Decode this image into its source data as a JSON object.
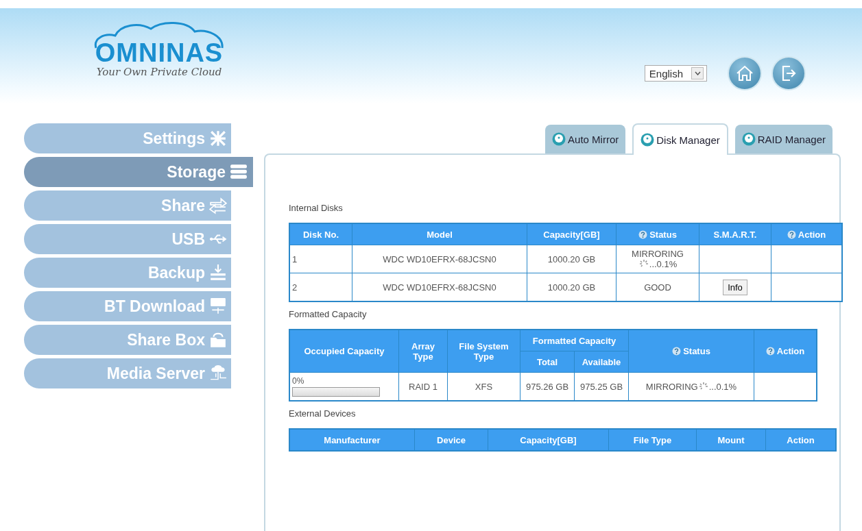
{
  "logo": {
    "name": "OMNINAS",
    "tagline": "Your Own Private Cloud"
  },
  "language": {
    "value": "English"
  },
  "sidebar": {
    "items": [
      {
        "label": "Settings",
        "selected": false
      },
      {
        "label": "Storage",
        "selected": true
      },
      {
        "label": "Share",
        "selected": false
      },
      {
        "label": "USB",
        "selected": false
      },
      {
        "label": "Backup",
        "selected": false
      },
      {
        "label": "BT Download",
        "selected": false
      },
      {
        "label": "Share Box",
        "selected": false
      },
      {
        "label": "Media Server",
        "selected": false
      }
    ]
  },
  "tabs": [
    {
      "label": "Auto Mirror",
      "selected": false
    },
    {
      "label": "Disk Manager",
      "selected": true
    },
    {
      "label": "RAID Manager",
      "selected": false
    }
  ],
  "internal_disks": {
    "title": "Internal Disks",
    "columns": [
      {
        "label": "Disk No."
      },
      {
        "label": "Model"
      },
      {
        "label": "Capacity[GB]"
      },
      {
        "label": "Status",
        "help": true
      },
      {
        "label": "S.M.A.R.T."
      },
      {
        "label": "Action",
        "help": true
      }
    ],
    "rows": [
      {
        "disk_no": "1",
        "model": "WDC WD10EFRX-68JCSN0",
        "capacity": "1000.20 GB",
        "status": "MIRRORING",
        "status_progress": "...0.1%"
      },
      {
        "disk_no": "2",
        "model": "WDC WD10EFRX-68JCSN0",
        "capacity": "1000.20 GB",
        "status": "GOOD",
        "smart_button": "Info"
      }
    ]
  },
  "formatted_capacity": {
    "title": "Formatted Capacity",
    "columns": {
      "occupied": "Occupied Capacity",
      "array_type": "Array Type",
      "fs_type": "File System Type",
      "formatted": "Formatted Capacity",
      "total": "Total",
      "available": "Available",
      "status": "Status",
      "action": "Action"
    },
    "rows": [
      {
        "occupied": "0%",
        "level": 0,
        "array_type": "RAID 1",
        "fs_type": "XFS",
        "total": "975.26 GB",
        "available": "975.25 GB",
        "status": "MIRRORING",
        "status_progress": "...0.1%"
      }
    ]
  },
  "external_devices": {
    "title": "External Devices",
    "columns": [
      "Manufacturer",
      "Device",
      "Capacity[GB]",
      "File Type",
      "Mount",
      "Action"
    ]
  }
}
